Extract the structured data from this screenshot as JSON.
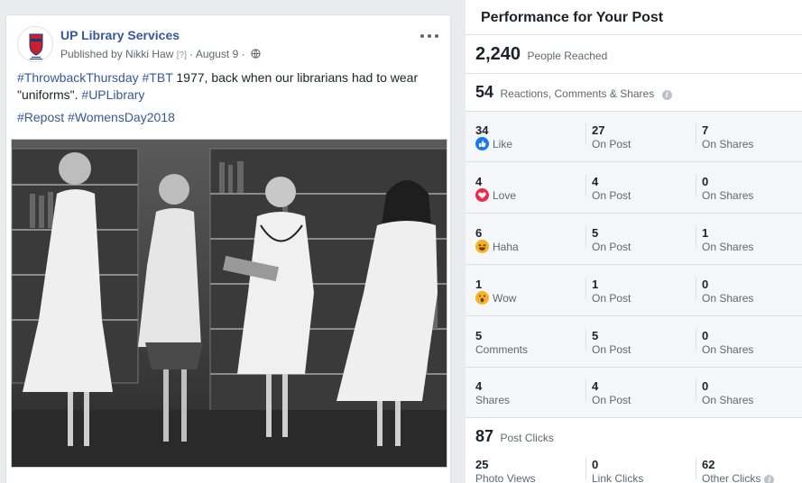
{
  "post": {
    "page_name": "UP Library Services",
    "published_by": "Published by Nikki Haw",
    "help_marker": "[?]",
    "date": "August 9",
    "separator": "·",
    "text_line1_tags": [
      "#ThrowbackThursday",
      "#TBT"
    ],
    "text_line1_body": " 1977, back when our librarians had to wear \"uniforms\". ",
    "text_line1_tag_end": "#UPLibrary",
    "text_line2_tags": [
      "#Repost",
      "#WomensDay2018"
    ]
  },
  "performance": {
    "title": "Performance for Your Post",
    "reach": {
      "value": "2,240",
      "label": "People Reached"
    },
    "engagement": {
      "value": "54",
      "label": "Reactions, Comments & Shares"
    },
    "rows": [
      {
        "total": "34",
        "label": "Like",
        "icon": "like-icon",
        "icon_color": "#1877f2",
        "on_post": "27",
        "on_post_label": "On Post",
        "on_shares": "7",
        "on_shares_label": "On Shares"
      },
      {
        "total": "4",
        "label": "Love",
        "icon": "love-icon",
        "icon_color": "#f0284a",
        "on_post": "4",
        "on_post_label": "On Post",
        "on_shares": "0",
        "on_shares_label": "On Shares"
      },
      {
        "total": "6",
        "label": "Haha",
        "icon": "haha-icon",
        "icon_color": "#f7b125",
        "on_post": "5",
        "on_post_label": "On Post",
        "on_shares": "1",
        "on_shares_label": "On Shares"
      },
      {
        "total": "1",
        "label": "Wow",
        "icon": "wow-icon",
        "icon_color": "#f7b125",
        "on_post": "1",
        "on_post_label": "On Post",
        "on_shares": "0",
        "on_shares_label": "On Shares"
      },
      {
        "total": "5",
        "label": "Comments",
        "icon": "",
        "icon_color": "",
        "on_post": "5",
        "on_post_label": "On Post",
        "on_shares": "0",
        "on_shares_label": "On Shares"
      },
      {
        "total": "4",
        "label": "Shares",
        "icon": "",
        "icon_color": "",
        "on_post": "4",
        "on_post_label": "On Post",
        "on_shares": "0",
        "on_shares_label": "On Shares"
      }
    ],
    "clicks": {
      "value": "87",
      "label": "Post Clicks",
      "photo_views": {
        "value": "25",
        "label": "Photo Views"
      },
      "link_clicks": {
        "value": "0",
        "label": "Link Clicks"
      },
      "other_clicks": {
        "value": "62",
        "label": "Other Clicks"
      }
    }
  },
  "colors": {
    "link_blue": "#365899",
    "background": "#e9ebee",
    "panel_grey": "#f5f6f7"
  }
}
